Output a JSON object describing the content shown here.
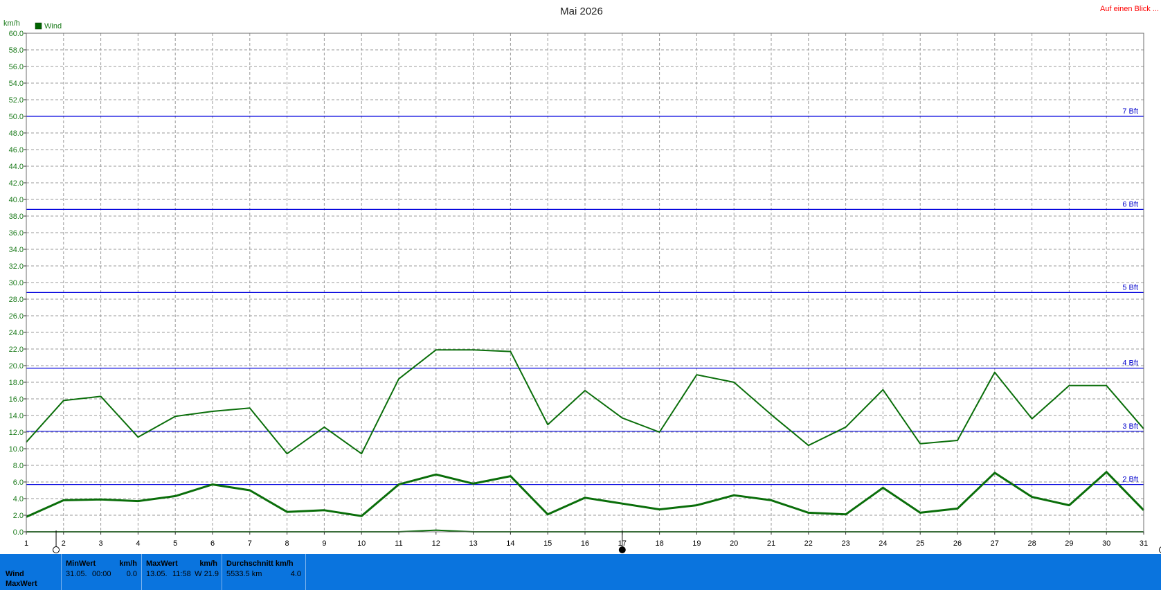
{
  "title": "Mai 2026",
  "link_text": "Auf einen Blick ...",
  "legend": {
    "label": "Wind",
    "color": "#006400"
  },
  "colors": {
    "series": "#0a6e0a",
    "grid": "#9a9a9a",
    "beaufort": "#0000dd",
    "stats_bg": "#0a74de"
  },
  "chart_data": {
    "type": "line",
    "title": "Mai 2026",
    "ylabel": "km/h",
    "xlabel": "",
    "ylim": [
      0,
      60
    ],
    "ytick_step": 2,
    "xlim": [
      1,
      31
    ],
    "x": [
      1,
      2,
      3,
      4,
      5,
      6,
      7,
      8,
      9,
      10,
      11,
      12,
      13,
      14,
      15,
      16,
      17,
      18,
      19,
      20,
      21,
      22,
      23,
      24,
      25,
      26,
      27,
      28,
      29,
      30,
      31
    ],
    "grid": true,
    "legend_position": "top-left",
    "series": [
      {
        "name": "Wind",
        "role": "max",
        "values": [
          10.8,
          15.8,
          16.3,
          11.4,
          13.9,
          14.5,
          14.9,
          9.4,
          12.6,
          9.4,
          18.4,
          21.9,
          21.9,
          21.7,
          12.9,
          17.0,
          13.7,
          12.0,
          18.9,
          18.0,
          14.1,
          10.4,
          12.6,
          17.1,
          10.6,
          11.0,
          19.2,
          13.6,
          17.6,
          17.6,
          12.4
        ]
      },
      {
        "name": "Wind",
        "role": "average",
        "values": [
          1.8,
          3.8,
          3.9,
          3.7,
          4.3,
          5.7,
          5.0,
          2.4,
          2.6,
          1.9,
          5.7,
          6.9,
          5.8,
          6.7,
          2.1,
          4.1,
          3.4,
          2.7,
          3.2,
          4.4,
          3.8,
          2.3,
          2.1,
          5.3,
          2.3,
          2.8,
          7.1,
          4.2,
          3.2,
          7.2,
          2.6
        ]
      },
      {
        "name": "Wind",
        "role": "min",
        "values": [
          0,
          0,
          0,
          0,
          0,
          0,
          0,
          0,
          0,
          0,
          0,
          0.2,
          0,
          0,
          0,
          0,
          0,
          0,
          0,
          0,
          0,
          0,
          0,
          0,
          0,
          0,
          0,
          0,
          0,
          0,
          0
        ]
      }
    ],
    "reference_lines": [
      {
        "label": "2 Bft",
        "value": 5.7
      },
      {
        "label": "3 Bft",
        "value": 12.1
      },
      {
        "label": "4 Bft",
        "value": 19.7
      },
      {
        "label": "5 Bft",
        "value": 28.8
      },
      {
        "label": "6 Bft",
        "value": 38.8
      },
      {
        "label": "7 Bft",
        "value": 50.0
      }
    ],
    "range_markers": [
      1.8,
      17,
      31.5
    ]
  },
  "stats": {
    "row_labels": [
      "Wind",
      "MaxWert"
    ],
    "min": {
      "header": "MinWert",
      "unit": "km/h",
      "date": "31.05.",
      "time": "00:00",
      "value": "0.0"
    },
    "max": {
      "header": "MaxWert",
      "unit": "km/h",
      "date": "13.05.",
      "time": "11:58",
      "value": "W 21.9"
    },
    "avg": {
      "header": "Durchschnitt km/h",
      "distance": "5533.5 km",
      "value": "4.0"
    }
  }
}
